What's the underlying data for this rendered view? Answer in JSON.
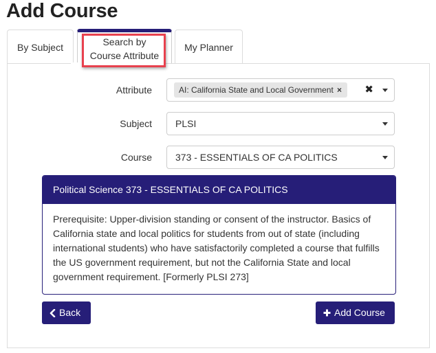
{
  "page": {
    "title": "Add Course"
  },
  "tabs": [
    {
      "label": "By Subject",
      "active": false
    },
    {
      "label": "Search by Course Attribute",
      "active": true
    },
    {
      "label": "My Planner",
      "active": false
    }
  ],
  "form": {
    "attribute": {
      "label": "Attribute",
      "selected_chip": "AI: California State and Local Government",
      "chip_remove_icon": "close-icon",
      "clear_icon": "clear-all-icon",
      "dropdown_icon": "caret-down-icon"
    },
    "subject": {
      "label": "Subject",
      "value": "PLSI",
      "dropdown_icon": "caret-down-icon"
    },
    "course": {
      "label": "Course",
      "value": "373 - ESSENTIALS OF CA POLITICS",
      "dropdown_icon": "caret-down-icon"
    }
  },
  "course_card": {
    "title": "Political Science 373 - ESSENTIALS OF CA POLITICS",
    "description": "Prerequisite: Upper-division standing or consent of the instructor. Basics of California state and local politics for students from out of state (including international students) who have satisfactorily completed a course that fulfills the US government requirement, but not the California State and local government requirement. [Formerly PLSI 273]"
  },
  "buttons": {
    "back": {
      "label": "Back",
      "icon": "chevron-left-icon"
    },
    "add_course": {
      "label": "Add Course",
      "icon": "plus-icon"
    }
  },
  "colors": {
    "brand": "#261e78",
    "highlight": "#e8414e"
  }
}
